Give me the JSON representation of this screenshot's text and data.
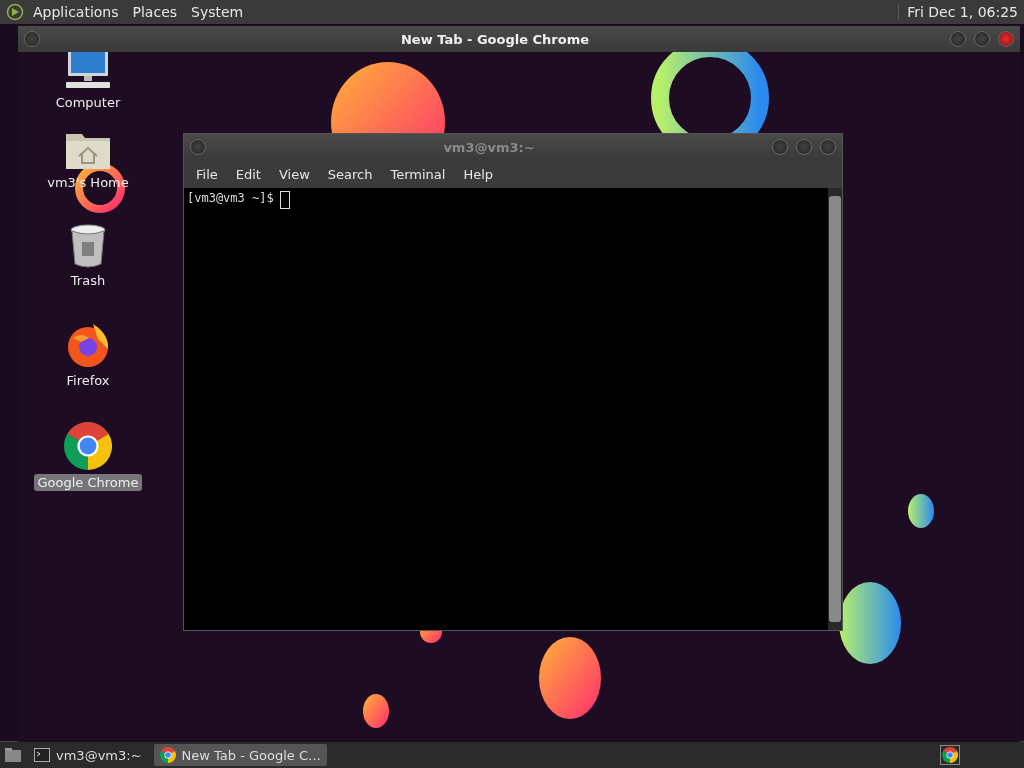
{
  "top_panel": {
    "menus": [
      "Applications",
      "Places",
      "System"
    ],
    "clock": "Fri Dec 1, 06:25"
  },
  "browser_window": {
    "title": "New Tab - Google Chrome"
  },
  "desktop_icons": [
    {
      "kind": "computer",
      "label": "Computer",
      "selected": false
    },
    {
      "kind": "home",
      "label": "vm3's Home",
      "selected": false
    },
    {
      "kind": "trash",
      "label": "Trash",
      "selected": false
    },
    {
      "kind": "firefox",
      "label": "Firefox",
      "selected": false
    },
    {
      "kind": "chrome",
      "label": "Google Chrome",
      "selected": true
    }
  ],
  "terminal_window": {
    "title": "vm3@vm3:~",
    "menus": [
      "File",
      "Edit",
      "View",
      "Search",
      "Terminal",
      "Help"
    ],
    "prompt": "[vm3@vm3 ~]$"
  },
  "taskbar": {
    "tasks": [
      {
        "kind": "terminal",
        "label": "vm3@vm3:~",
        "selected": false
      },
      {
        "kind": "chrome",
        "label": "New Tab - Google C…",
        "selected": true
      }
    ],
    "tray": [
      {
        "kind": "chrome"
      }
    ]
  }
}
